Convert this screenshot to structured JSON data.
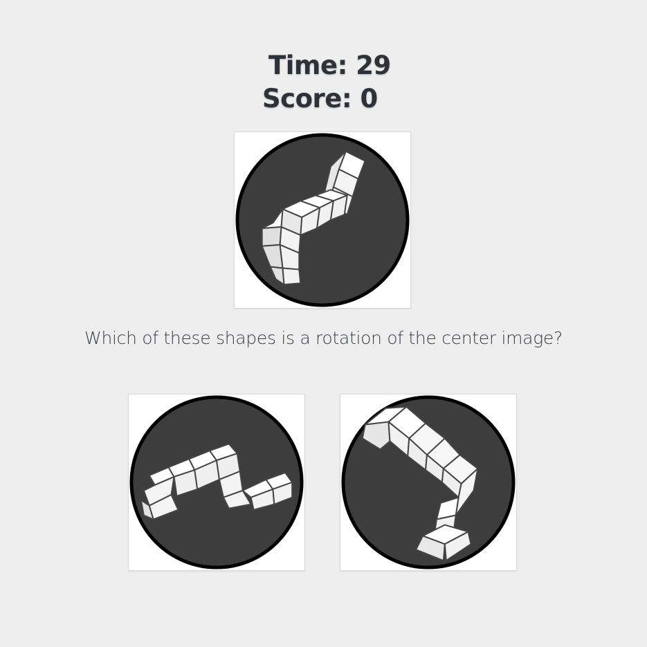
{
  "stats": {
    "time_label": "Time:",
    "time_value": "29",
    "score_label": "Score:",
    "score_value": "0"
  },
  "question": "Which of these shapes is a rotation of the center image?",
  "images": {
    "center": "center-shape-image",
    "options": [
      "option-shape-image-1",
      "option-shape-image-2"
    ]
  },
  "colors": {
    "background": "#eeeeee",
    "circle_fill": "#3d3d3d",
    "circle_border": "#000000",
    "cube_face": "#ffffff",
    "cube_shade": "#e4e4e4",
    "text": "#2e3138"
  }
}
